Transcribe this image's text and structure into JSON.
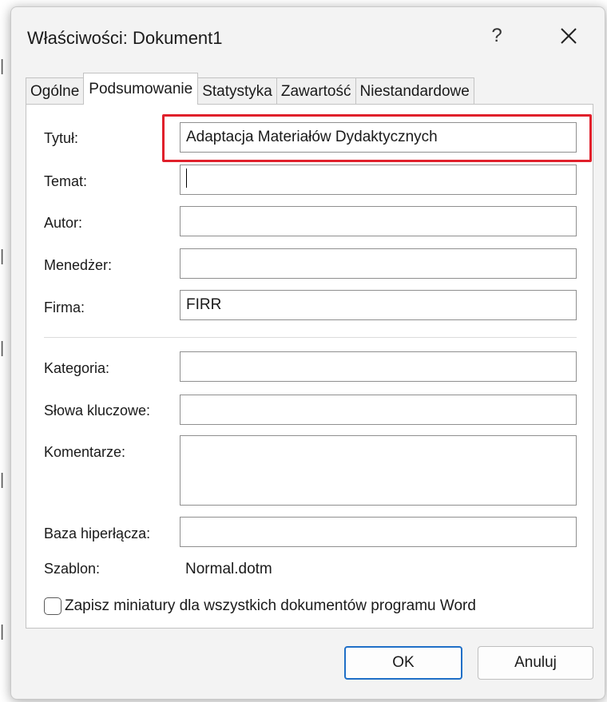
{
  "dialog": {
    "title": "Właściwości: Dokument1",
    "help_label": "?",
    "close_icon": "close-icon"
  },
  "tabs": [
    {
      "label": "Ogólne",
      "active": false
    },
    {
      "label": "Podsumowanie",
      "active": true
    },
    {
      "label": "Statystyka",
      "active": false
    },
    {
      "label": "Zawartość",
      "active": false
    },
    {
      "label": "Niestandardowe",
      "active": false
    }
  ],
  "fields": {
    "title": {
      "label": "Tytuł:",
      "value": "Adaptacja Materiałów Dydaktycznych"
    },
    "subject": {
      "label": "Temat:",
      "value": ""
    },
    "author": {
      "label": "Autor:",
      "value": ""
    },
    "manager": {
      "label": "Menedżer:",
      "value": ""
    },
    "company": {
      "label": "Firma:",
      "value": "FIRR"
    },
    "category": {
      "label": "Kategoria:",
      "value": ""
    },
    "keywords": {
      "label": "Słowa kluczowe:",
      "value": ""
    },
    "comments": {
      "label": "Komentarze:",
      "value": ""
    },
    "hyperlink_base": {
      "label": "Baza hiperłącza:",
      "value": ""
    },
    "template": {
      "label": "Szablon:",
      "value": "Normal.dotm"
    }
  },
  "thumbnail_checkbox": {
    "label": "Zapisz miniatury dla wszystkich dokumentów programu Word",
    "checked": false
  },
  "buttons": {
    "ok": "OK",
    "cancel": "Anuluj"
  },
  "colors": {
    "highlight": "#e0202b",
    "ok_border": "#1f6fc7"
  }
}
